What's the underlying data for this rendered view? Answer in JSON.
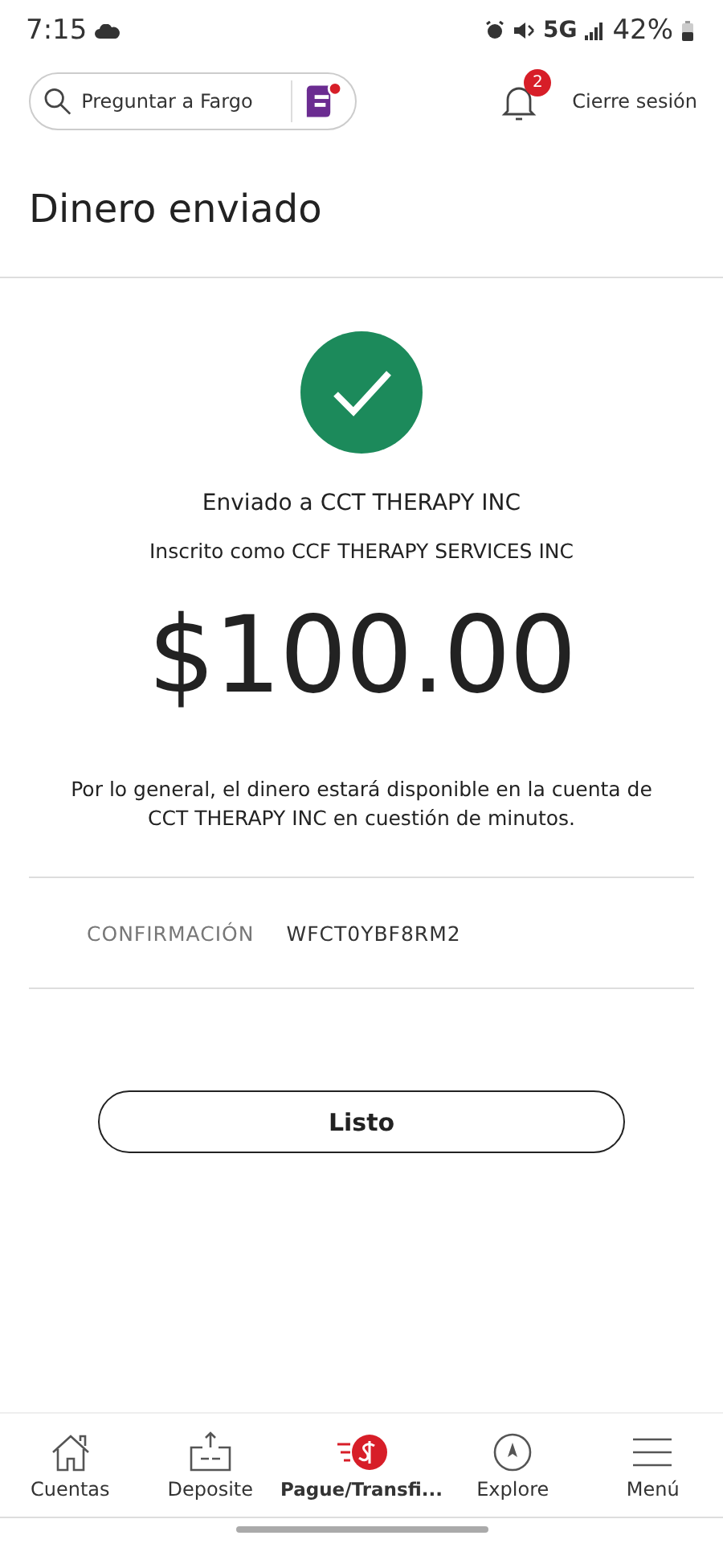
{
  "status_bar": {
    "time": "7:15",
    "network": "5G",
    "battery": "42%"
  },
  "header": {
    "search": {
      "placeholder": "Preguntar a Fargo"
    },
    "notifications": {
      "count": "2"
    },
    "logout": "Cierre sesión"
  },
  "page": {
    "title": "Dinero enviado"
  },
  "confirmation": {
    "sent_to": "Enviado a CCT THERAPY INC",
    "enrolled_as": "Inscrito como CCF THERAPY SERVICES INC",
    "amount": "$100.00",
    "note": "Por lo general, el dinero estará disponible en la cuenta de CCT THERAPY INC en cuestión de minutos.",
    "code_label": "CONFIRMACIÓN",
    "code": "WFCT0YBF8RM2",
    "done_button": "Listo"
  },
  "bottom_nav": [
    {
      "kind": "home",
      "label": "Cuentas",
      "selected": false
    },
    {
      "kind": "deposit",
      "label": "Deposite",
      "selected": false
    },
    {
      "kind": "pay",
      "label": "Pague/Transfi...",
      "selected": true
    },
    {
      "kind": "explore",
      "label": "Explore",
      "selected": false
    },
    {
      "kind": "menu",
      "label": "Menú",
      "selected": false
    }
  ]
}
